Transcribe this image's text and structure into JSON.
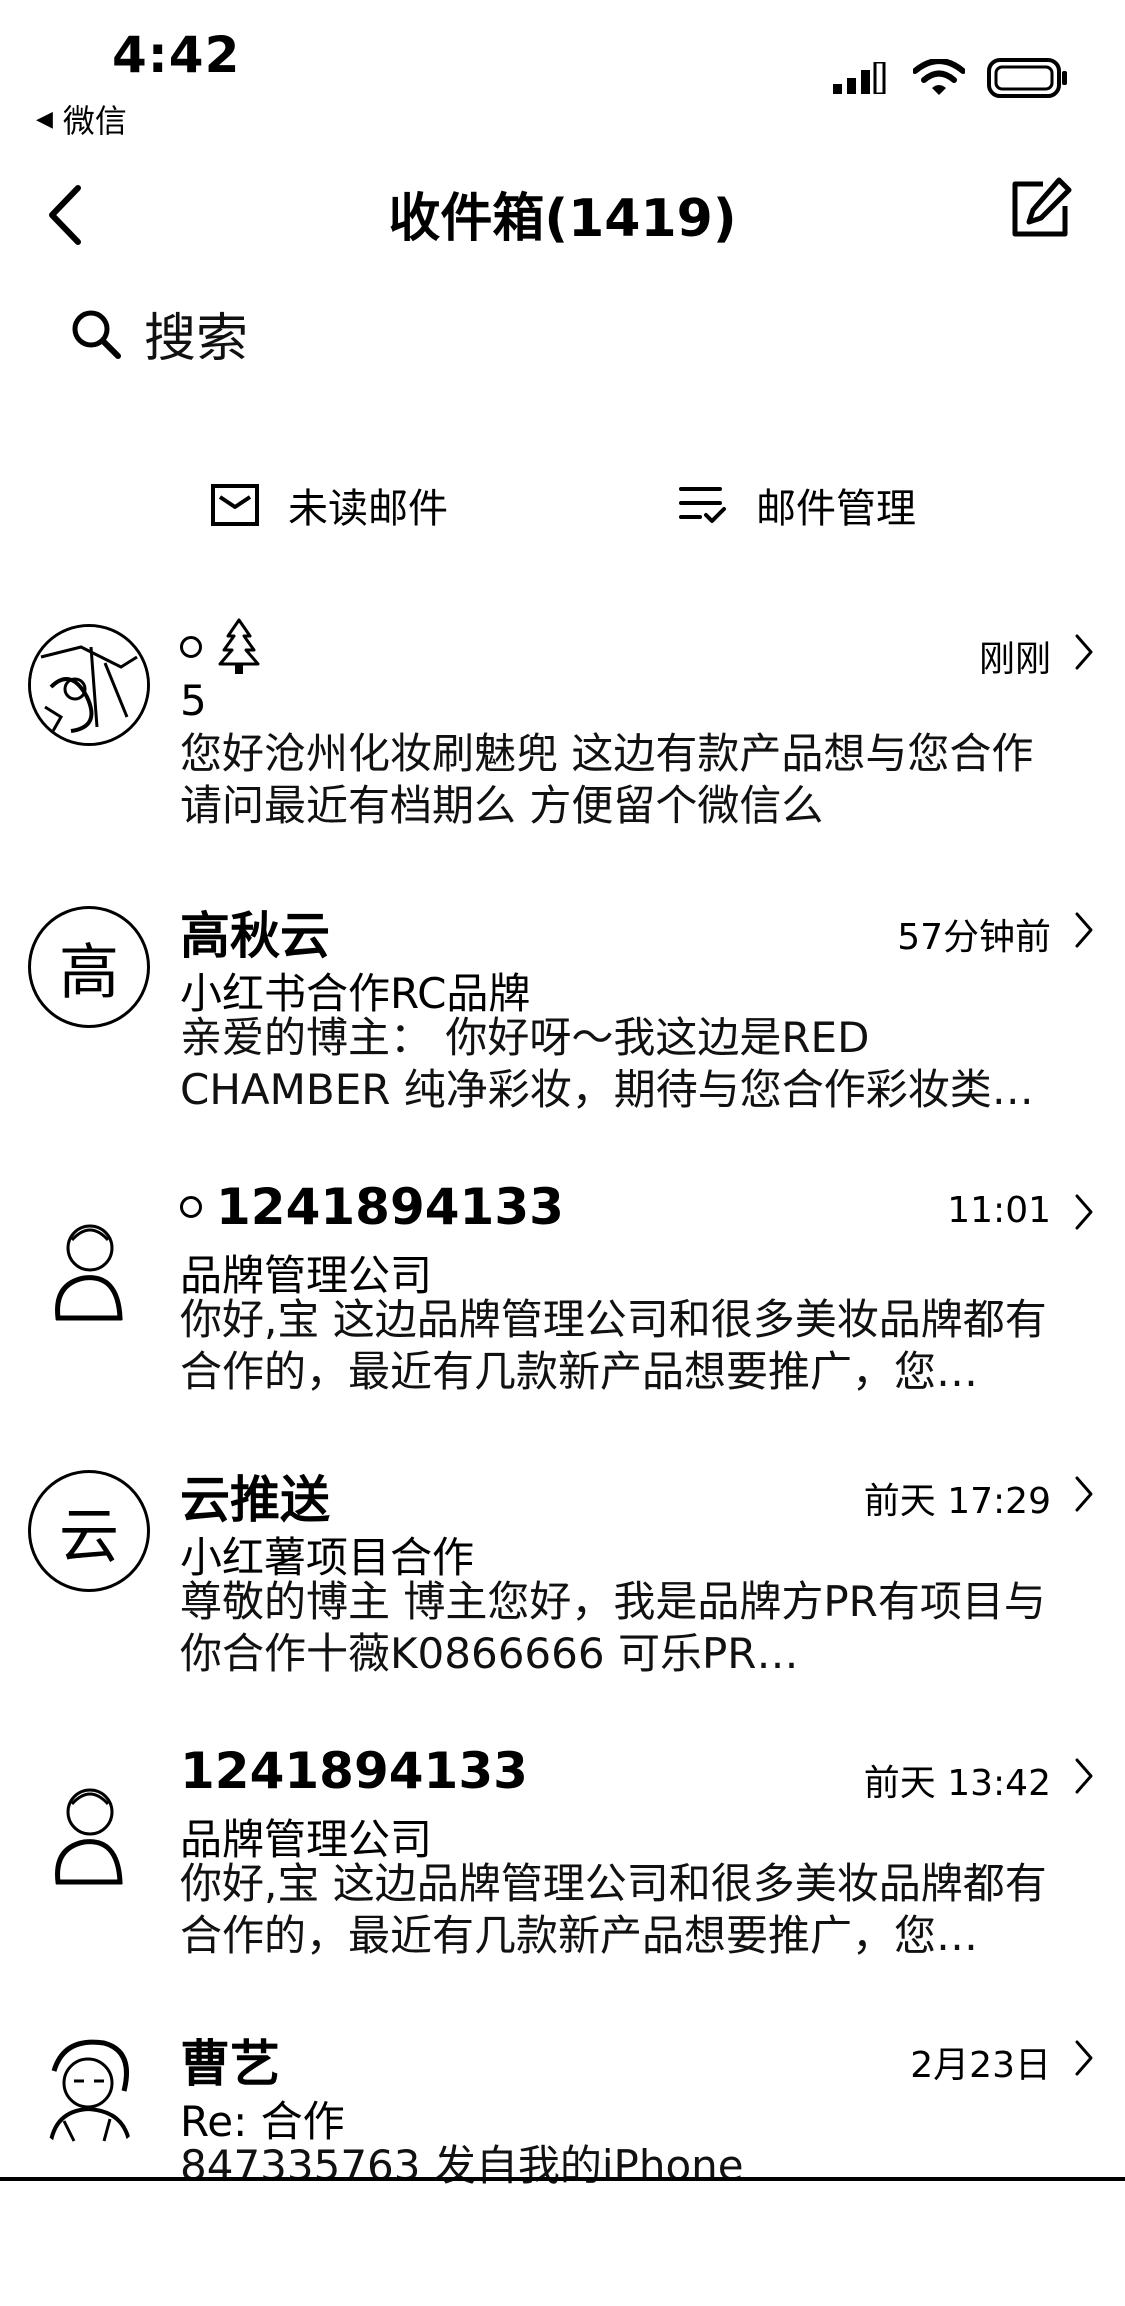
{
  "status_bar": {
    "time": "4:42",
    "back_app": "微信"
  },
  "nav": {
    "title": "收件箱(1419)"
  },
  "search": {
    "placeholder": "搜索"
  },
  "actions": {
    "unread_label": "未读邮件",
    "manage_label": "邮件管理"
  },
  "mails": [
    {
      "sender": "5",
      "sender_icon": "tree-icon",
      "unread": true,
      "time": "刚刚",
      "subject": "",
      "preview": "您好沧州化妆刷魅兜 这边有款产品想与您合作 请问最近有档期么 方便留个微信么",
      "avatar_text": ""
    },
    {
      "sender": "高秋云",
      "unread": false,
      "time": "57分钟前",
      "subject": "小红书合作RC品牌",
      "preview": "亲爱的博主： 你好呀～我这边是RED CHAMBER 纯净彩妆，期待与您合作彩妆类…",
      "avatar_text": "高"
    },
    {
      "sender": "1241894133",
      "unread": true,
      "time": "11:01",
      "subject": "品牌管理公司",
      "preview": "你好,宝 这边品牌管理公司和很多美妆品牌都有合作的，最近有几款新产品想要推广，您…",
      "avatar_text": ""
    },
    {
      "sender": "云推送",
      "unread": false,
      "time": "前天 17:29",
      "subject": "小红薯项目合作",
      "preview": "尊敬的博主 博主您好，我是品牌方PR有项目与你合作十薇K0866666 可乐PR…",
      "avatar_text": "云"
    },
    {
      "sender": "1241894133",
      "unread": false,
      "time": "前天 13:42",
      "subject": "品牌管理公司",
      "preview": "你好,宝 这边品牌管理公司和很多美妆品牌都有合作的，最近有几款新产品想要推广，您…",
      "avatar_text": ""
    },
    {
      "sender": "曹艺",
      "unread": false,
      "time": "2月23日",
      "subject": "Re: 合作",
      "preview": "847335763 发自我的iPhone",
      "avatar_text": ""
    }
  ]
}
